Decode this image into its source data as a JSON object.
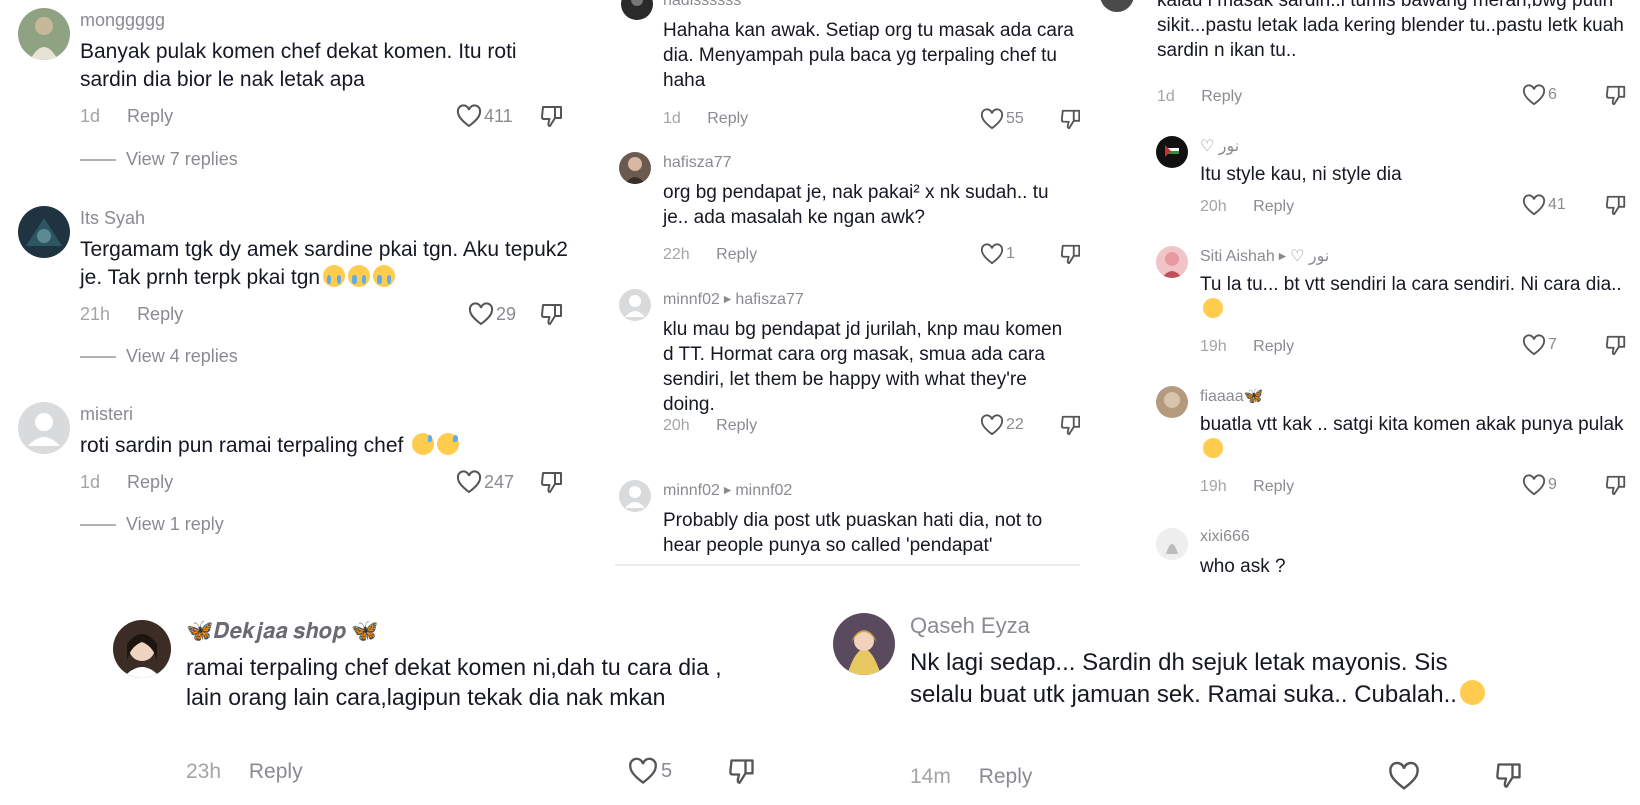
{
  "panels": {
    "left": {
      "comments": [
        {
          "username": "monggggg",
          "text": "Banyak pulak komen chef dekat komen. Itu roti sardin dia bior le nak letak apa",
          "time": "1d",
          "reply": "Reply",
          "likes": "411",
          "view_replies": "View 7 replies"
        },
        {
          "username": "Its Syah",
          "text": "Tergamam tgk dy amek sardine pkai tgn. Aku tepuk2 je. Tak prnh terpk pkai tgn",
          "time": "21h",
          "reply": "Reply",
          "likes": "29",
          "view_replies": "View 4 replies"
        },
        {
          "username": "misteri",
          "text": "roti sardin pun ramai terpaling chef",
          "time": "1d",
          "reply": "Reply",
          "likes": "247",
          "view_replies": "View 1 reply"
        }
      ]
    },
    "middle": {
      "comments": [
        {
          "username": "hadissssss",
          "text": "Hahaha kan awak. Setiap org tu masak ada cara dia. Menyampah pula baca yg terpaling chef tu haha",
          "time": "1d",
          "reply": "Reply",
          "likes": "55"
        },
        {
          "username": "hafisza77",
          "text": "org bg pendapat je, nak pakai² x nk sudah.. tu je.. ada masalah ke ngan awk?",
          "time": "22h",
          "reply": "Reply",
          "likes": "1"
        },
        {
          "username": "minnf02",
          "reply_to": "hafisza77",
          "text": "klu mau bg pendapat jd jurilah, knp mau komen d TT. Hormat cara org masak, smua ada cara sendiri, let them be happy with what they're doing.",
          "time": "20h",
          "reply": "Reply",
          "likes": "22"
        },
        {
          "username": "minnf02",
          "reply_to": "minnf02",
          "text": "Probably dia post utk puaskan hati dia, not to hear people punya so called 'pendapat'"
        }
      ]
    },
    "right": {
      "comments": [
        {
          "text": "kalau i masak sardin..i tumis bawang merah,bwg putih sikit...pastu letak lada kering blender tu..pastu letk kuah sardin n ikan tu..",
          "time": "1d",
          "reply": "Reply",
          "likes": "6"
        },
        {
          "username": "♡ نور",
          "text": "Itu style kau, ni style dia",
          "time": "20h",
          "reply": "Reply",
          "likes": "41"
        },
        {
          "username": "Siti Aishah",
          "reply_to": "♡ نور",
          "text": "Tu la tu... bt vtt sendiri la cara sendiri. Ni cara dia..",
          "time": "19h",
          "reply": "Reply",
          "likes": "7"
        },
        {
          "username": "fiaaaa🦋",
          "text": "buatla vtt kak .. satgi kita komen akak punya pulak",
          "time": "19h",
          "reply": "Reply",
          "likes": "9"
        },
        {
          "username": "xixi666",
          "text": "who ask ?"
        }
      ]
    },
    "bottom_left": {
      "username": "🦋𝑫𝒆𝒌𝒋𝒂𝒂 𝒔𝒉𝒐𝒑 🦋",
      "text": "ramai terpaling chef dekat komen ni,dah tu cara dia , lain orang lain cara,lagipun tekak dia nak mkan",
      "time": "23h",
      "reply": "Reply",
      "likes": "5"
    },
    "bottom_right": {
      "username": "Qaseh Eyza",
      "text": "Nk lagi sedap... Sardin dh sejuk letak mayonis. Sis selalu buat utk jamuan sek. Ramai suka.. Cubalah..",
      "time": "14m",
      "reply": "Reply"
    }
  },
  "colors": {
    "text": "#161823",
    "muted": "#8a8b91",
    "time": "#a3a4a8",
    "background": "#ffffff"
  }
}
